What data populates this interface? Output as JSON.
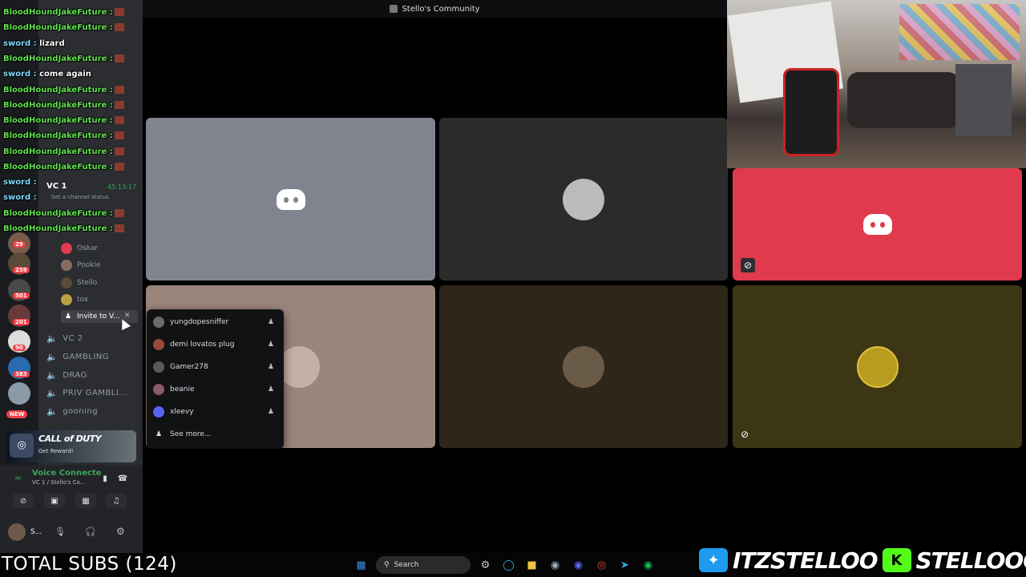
{
  "window": {
    "title": "Stello's Community"
  },
  "chat": [
    {
      "name": "BloodHoundJakeFuture :",
      "text": "",
      "color": "n1",
      "emote": true
    },
    {
      "name": "BloodHoundJakeFuture :",
      "text": "",
      "color": "n1",
      "emote": true
    },
    {
      "name": "sword :",
      "text": "lizard",
      "color": "n2",
      "emote": false
    },
    {
      "name": "BloodHoundJakeFuture :",
      "text": "",
      "color": "n1",
      "emote": true
    },
    {
      "name": "sword :",
      "text": "come again",
      "color": "n2",
      "emote": false
    },
    {
      "name": "BloodHoundJakeFuture :",
      "text": "",
      "color": "n1",
      "emote": true
    },
    {
      "name": "BloodHoundJakeFuture :",
      "text": "",
      "color": "n1",
      "emote": true
    },
    {
      "name": "BloodHoundJakeFuture :",
      "text": "",
      "color": "n1",
      "emote": true
    },
    {
      "name": "BloodHoundJakeFuture :",
      "text": "",
      "color": "n1",
      "emote": true
    },
    {
      "name": "BloodHoundJakeFuture :",
      "text": "",
      "color": "n1",
      "emote": true
    },
    {
      "name": "BloodHoundJakeFuture :",
      "text": "",
      "color": "n1",
      "emote": true
    },
    {
      "name": "sword :",
      "text": "",
      "color": "n2",
      "emote": false
    },
    {
      "name": "sword :",
      "text": "",
      "color": "n2",
      "emote": false
    },
    {
      "name": "BloodHoundJakeFuture :",
      "text": "",
      "color": "n1",
      "emote": true
    },
    {
      "name": "BloodHoundJakeFuture :",
      "text": "",
      "color": "n1",
      "emote": true
    }
  ],
  "servers": {
    "badges": [
      "29",
      "259",
      "501",
      "201",
      "90",
      "383"
    ],
    "new_label": "NEW"
  },
  "channels": {
    "vc1_title": "VC 1",
    "vc1_time": "45:13:17",
    "vc1_status": "Set a channel status",
    "users": [
      "Oskar",
      "Pookie",
      "Stello",
      "tox"
    ],
    "invite_label": "Invite to V...",
    "list": [
      "VC 2",
      "GAMBLING",
      "DRAG",
      "PRIV GAMBLI...",
      "gooning"
    ]
  },
  "promo": {
    "title": "CALL of DUTY",
    "sub": "Get Reward!"
  },
  "voice": {
    "status": "Voice Connecte",
    "channel": "VC 1 / Stello's Co...",
    "user": "S..."
  },
  "invite_popup": {
    "items": [
      "yungdopesniffer",
      "demi lovatos plug",
      "Gamer278",
      "beanie",
      "xleevy"
    ],
    "see_more": "See more..."
  },
  "overlay": {
    "subs": "TOTAL SUBS (124)",
    "twitter": "ITZSTELLOO",
    "kick": "STELLOOO"
  },
  "taskbar": {
    "search_placeholder": "Search"
  },
  "colors": {
    "tile_grey": "#80848e",
    "tile_red": "#e03a4c",
    "tile_dark": "#2b2b2b",
    "tile_brown": "#9a857a",
    "tile_olive": "#3d3614",
    "tile_darkbrown": "#2e2618"
  }
}
